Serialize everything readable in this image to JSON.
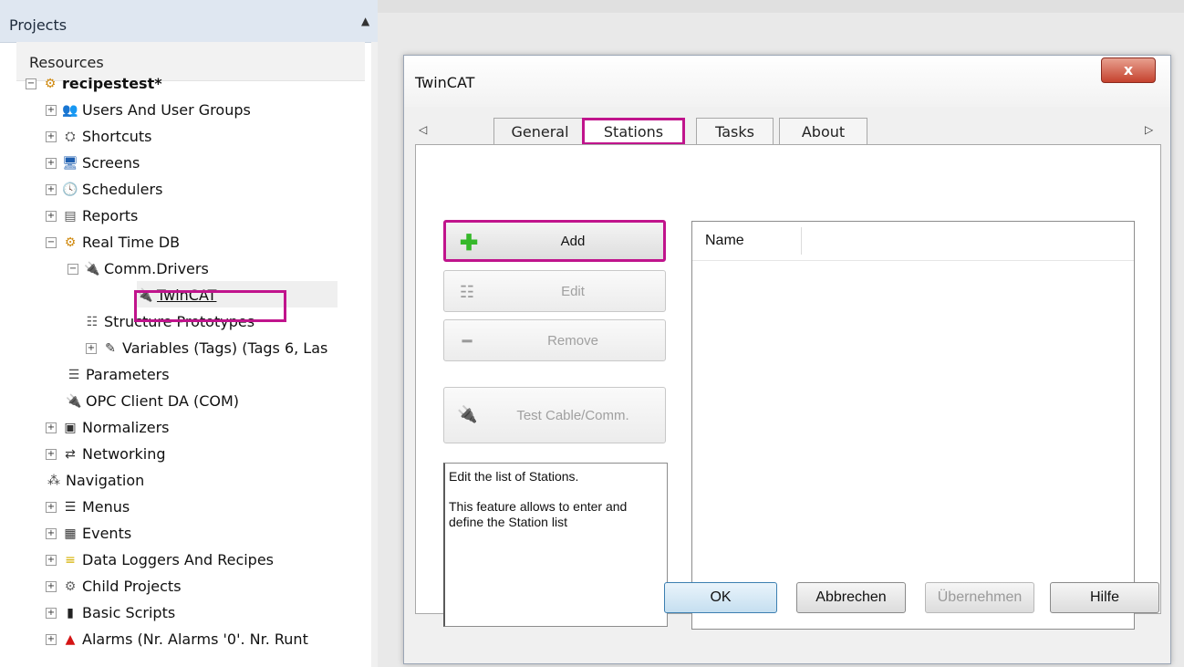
{
  "projects_panel": {
    "title": "Projects",
    "resources_label": "Resources",
    "tree": [
      {
        "label": "recipestest*",
        "icon": "gear-icon",
        "expander": "⊟"
      },
      {
        "label": "Users And User Groups",
        "icon": "users-icon",
        "expander": "⊞"
      },
      {
        "label": "Shortcuts",
        "icon": "shortcut-icon",
        "expander": "⊞"
      },
      {
        "label": "Screens",
        "icon": "monitor-icon",
        "expander": "⊞"
      },
      {
        "label": "Schedulers",
        "icon": "clock-icon",
        "expander": "⊞"
      },
      {
        "label": "Reports",
        "icon": "report-icon",
        "expander": "⊞"
      },
      {
        "label": "Real Time DB",
        "icon": "gear-icon",
        "expander": "⊟"
      },
      {
        "label": "Comm.Drivers",
        "icon": "plug-icon",
        "expander": "⊟"
      },
      {
        "label": "TwinCAT",
        "icon": "plug-icon",
        "expander": ""
      },
      {
        "label": "Structure Prototypes",
        "icon": "structure-icon",
        "expander": ""
      },
      {
        "label": "Variables (Tags) (Tags 6, Las",
        "icon": "tags-icon",
        "expander": "⊞"
      },
      {
        "label": "Parameters",
        "icon": "parameters-icon",
        "expander": ""
      },
      {
        "label": "OPC Client DA (COM)",
        "icon": "plug-icon",
        "expander": ""
      },
      {
        "label": "Normalizers",
        "icon": "normalizer-icon",
        "expander": "⊞"
      },
      {
        "label": "Networking",
        "icon": "network-icon",
        "expander": "⊞"
      },
      {
        "label": "Navigation",
        "icon": "navigation-icon",
        "expander": ""
      },
      {
        "label": "Menus",
        "icon": "menu-icon",
        "expander": "⊞"
      },
      {
        "label": "Events",
        "icon": "events-icon",
        "expander": "⊞"
      },
      {
        "label": "Data Loggers And Recipes",
        "icon": "database-icon",
        "expander": "⊞"
      },
      {
        "label": "Child Projects",
        "icon": "child-projects-icon",
        "expander": "⊞"
      },
      {
        "label": "Basic Scripts",
        "icon": "script-icon",
        "expander": "⊞"
      },
      {
        "label": "Alarms (Nr. Alarms '0'. Nr. Runt",
        "icon": "alarm-bell-icon",
        "expander": "⊞"
      }
    ]
  },
  "dialog": {
    "title": "TwinCAT",
    "close_label": "x",
    "tabs": {
      "general": "General",
      "stations": "Stations",
      "tasks": "Tasks",
      "about": "About",
      "active": "Stations"
    },
    "buttons": {
      "add": "Add",
      "edit": "Edit",
      "remove": "Remove",
      "test": "Test Cable/Comm."
    },
    "description": {
      "line1": "Edit the list of Stations.",
      "line2": "This feature allows to enter and define the Station list"
    },
    "list": {
      "column_name": "Name"
    },
    "footer": {
      "ok": "OK",
      "cancel": "Abbrechen",
      "apply": "Übernehmen",
      "help": "Hilfe"
    }
  },
  "colors": {
    "highlight": "#c0148c",
    "add_icon": "#35b82a",
    "close_button": "#c5422e"
  }
}
